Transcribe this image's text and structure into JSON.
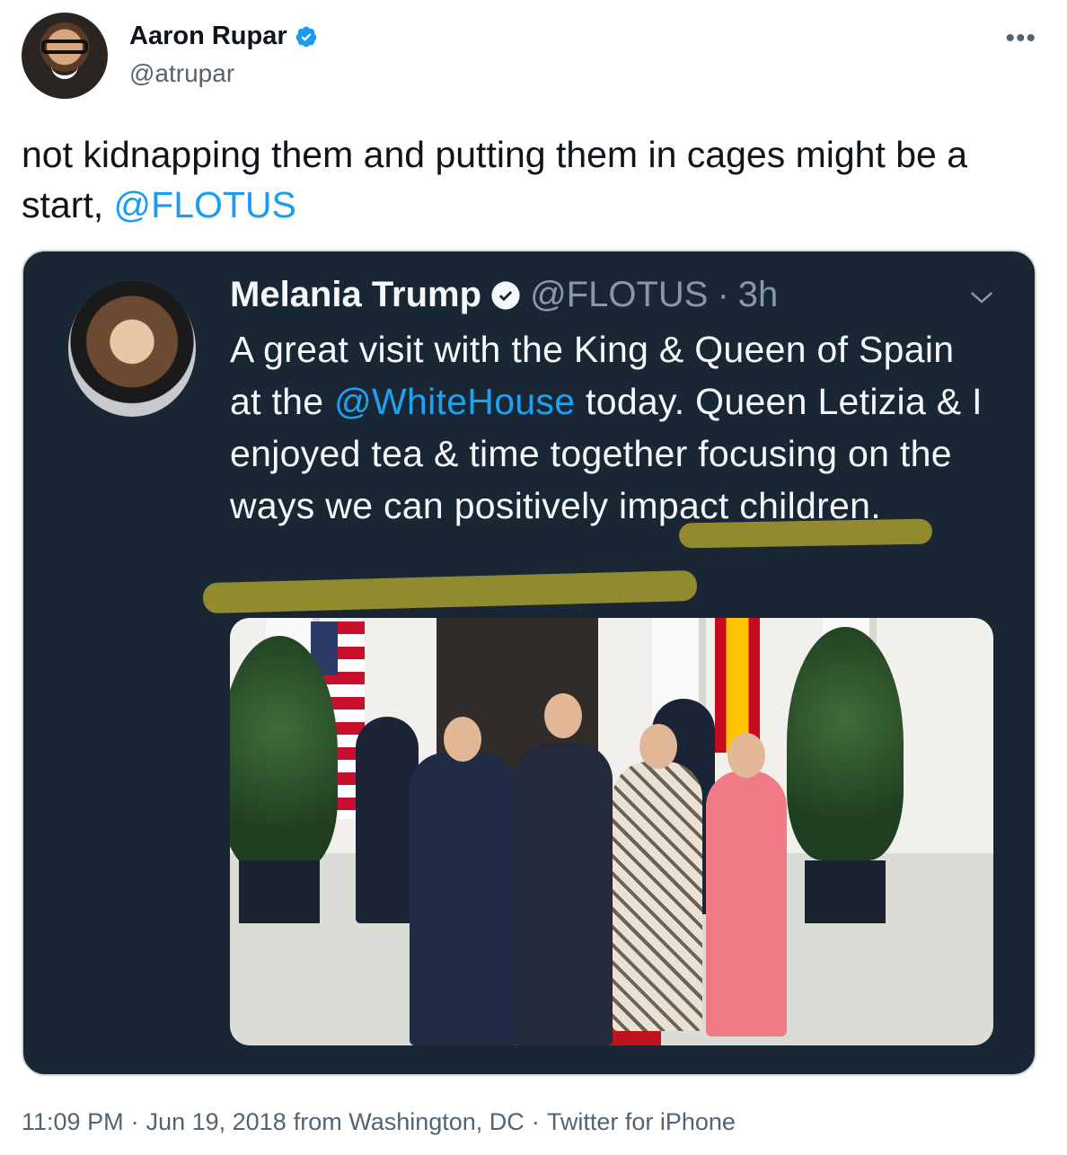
{
  "author": {
    "display_name": "Aaron Rupar",
    "handle": "@atrupar"
  },
  "tweet": {
    "text_before": "not kidnapping them and putting them in cages might be a start, ",
    "mention": "@FLOTUS"
  },
  "quoted": {
    "display_name": "Melania Trump",
    "handle": "@FLOTUS",
    "separator": "·",
    "time": "3h",
    "text_1": "A great visit with the King & Queen of Spain at the ",
    "mention": "@WhiteHouse",
    "text_2": " today. Queen Letizia & I enjoyed tea & time together focusing on the ways we can positively impact children."
  },
  "footer": {
    "time": "11:09 PM",
    "dot1": "·",
    "date": "Jun 19, 2018",
    "location": "from Washington, DC",
    "dot2": "·",
    "source": "Twitter for iPhone"
  },
  "colors": {
    "link": "#1d9bf0",
    "card_bg": "#192734",
    "highlighter": "#c4b52c"
  },
  "icons": {
    "verified": "verified-badge-icon",
    "more": "more-options-icon",
    "chevron": "chevron-down-icon"
  }
}
